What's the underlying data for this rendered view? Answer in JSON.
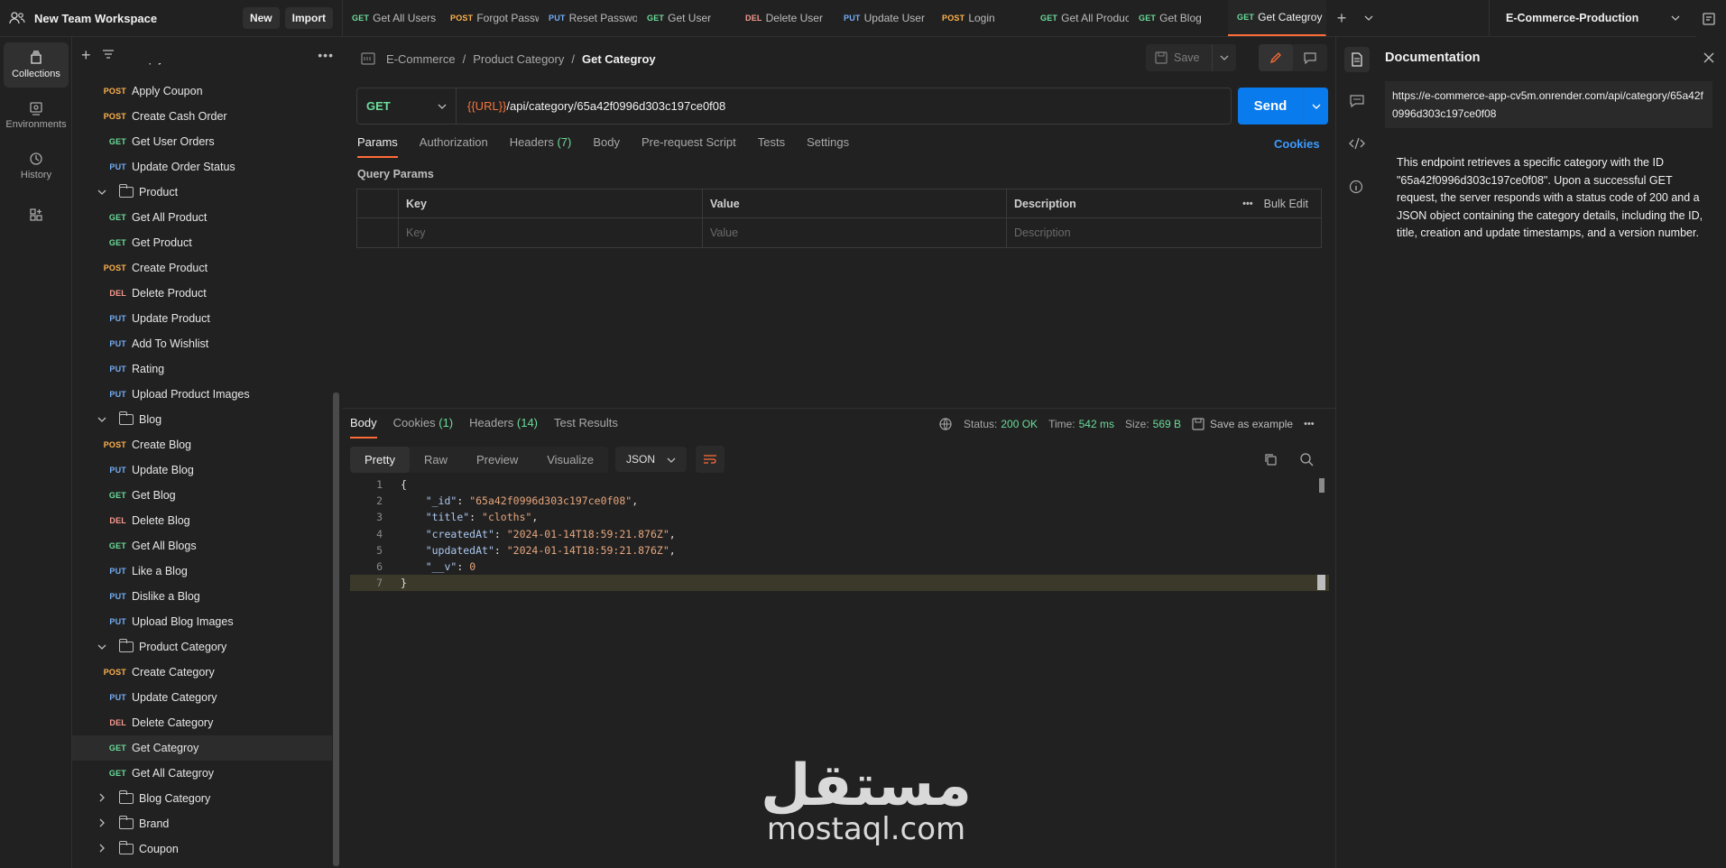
{
  "workspace": {
    "name": "New Team Workspace",
    "new_label": "New",
    "import_label": "Import"
  },
  "rail": [
    {
      "label": "Collections",
      "icon": "collections-icon",
      "active": true
    },
    {
      "label": "Environments",
      "icon": "environments-icon",
      "active": false
    },
    {
      "label": "History",
      "icon": "history-icon",
      "active": false
    }
  ],
  "tree": [
    {
      "kind": "req",
      "method": "",
      "label": "Empty Cart",
      "depth": 2,
      "clipped": true
    },
    {
      "kind": "req",
      "method": "POST",
      "label": "Apply Coupon",
      "depth": 2
    },
    {
      "kind": "req",
      "method": "POST",
      "label": "Create Cash Order",
      "depth": 2
    },
    {
      "kind": "req",
      "method": "GET",
      "label": "Get User Orders",
      "depth": 2
    },
    {
      "kind": "req",
      "method": "PUT",
      "label": "Update Order Status",
      "depth": 2
    },
    {
      "kind": "folder",
      "label": "Product",
      "open": true
    },
    {
      "kind": "req",
      "method": "GET",
      "label": "Get All Product",
      "depth": 2
    },
    {
      "kind": "req",
      "method": "GET",
      "label": "Get Product",
      "depth": 2
    },
    {
      "kind": "req",
      "method": "POST",
      "label": "Create Product",
      "depth": 2
    },
    {
      "kind": "req",
      "method": "DEL",
      "label": "Delete Product",
      "depth": 2
    },
    {
      "kind": "req",
      "method": "PUT",
      "label": "Update Product",
      "depth": 2
    },
    {
      "kind": "req",
      "method": "PUT",
      "label": "Add To Wishlist",
      "depth": 2
    },
    {
      "kind": "req",
      "method": "PUT",
      "label": "Rating",
      "depth": 2
    },
    {
      "kind": "req",
      "method": "PUT",
      "label": "Upload Product Images",
      "depth": 2
    },
    {
      "kind": "folder",
      "label": "Blog",
      "open": true
    },
    {
      "kind": "req",
      "method": "POST",
      "label": "Create Blog",
      "depth": 2
    },
    {
      "kind": "req",
      "method": "PUT",
      "label": "Update Blog",
      "depth": 2
    },
    {
      "kind": "req",
      "method": "GET",
      "label": "Get Blog",
      "depth": 2
    },
    {
      "kind": "req",
      "method": "DEL",
      "label": "Delete Blog",
      "depth": 2
    },
    {
      "kind": "req",
      "method": "GET",
      "label": "Get All Blogs",
      "depth": 2
    },
    {
      "kind": "req",
      "method": "PUT",
      "label": "Like a Blog",
      "depth": 2
    },
    {
      "kind": "req",
      "method": "PUT",
      "label": "Dislike a Blog",
      "depth": 2
    },
    {
      "kind": "req",
      "method": "PUT",
      "label": "Upload Blog Images",
      "depth": 2
    },
    {
      "kind": "folder",
      "label": "Product Category",
      "open": true
    },
    {
      "kind": "req",
      "method": "POST",
      "label": "Create Category",
      "depth": 2
    },
    {
      "kind": "req",
      "method": "PUT",
      "label": "Update Category",
      "depth": 2
    },
    {
      "kind": "req",
      "method": "DEL",
      "label": "Delete Category",
      "depth": 2
    },
    {
      "kind": "req",
      "method": "GET",
      "label": "Get Categroy",
      "depth": 2,
      "selected": true
    },
    {
      "kind": "req",
      "method": "GET",
      "label": "Get All Categroy",
      "depth": 2
    },
    {
      "kind": "folder",
      "label": "Blog Category",
      "open": false
    },
    {
      "kind": "folder",
      "label": "Brand",
      "open": false
    },
    {
      "kind": "folder",
      "label": "Coupon",
      "open": false
    }
  ],
  "tabs": [
    {
      "method": "GET",
      "label": "Get All Users"
    },
    {
      "method": "POST",
      "label": "Forgot Passw"
    },
    {
      "method": "PUT",
      "label": "Reset Passwor"
    },
    {
      "method": "GET",
      "label": "Get User"
    },
    {
      "method": "DEL",
      "label": "Delete User"
    },
    {
      "method": "PUT",
      "label": "Update User"
    },
    {
      "method": "POST",
      "label": "Login"
    },
    {
      "method": "GET",
      "label": "Get All Produc"
    },
    {
      "method": "GET",
      "label": "Get Blog"
    },
    {
      "method": "GET",
      "label": "Get Categroy",
      "active": true
    }
  ],
  "environment": "E-Commerce-Production",
  "breadcrumb": {
    "collection": "E-Commerce",
    "folder": "Product Category",
    "current": "Get Categroy"
  },
  "save_label": "Save",
  "request": {
    "method": "GET",
    "url_var": "{{URL}}",
    "url_path": "/api/category/65a42f0996d303c197ce0f08",
    "send_label": "Send"
  },
  "req_tabs": [
    {
      "label": "Params",
      "active": true
    },
    {
      "label": "Authorization"
    },
    {
      "label": "Headers",
      "count": "(7)"
    },
    {
      "label": "Body"
    },
    {
      "label": "Pre-request Script"
    },
    {
      "label": "Tests"
    },
    {
      "label": "Settings"
    }
  ],
  "cookies_label": "Cookies",
  "query_params": {
    "label": "Query Params",
    "headers": {
      "key": "Key",
      "value": "Value",
      "description": "Description",
      "bulk_edit": "Bulk Edit"
    },
    "placeholders": {
      "key": "Key",
      "value": "Value",
      "description": "Description"
    }
  },
  "response": {
    "tabs": [
      {
        "label": "Body",
        "active": true
      },
      {
        "label": "Cookies",
        "count": "(1)"
      },
      {
        "label": "Headers",
        "count": "(14)"
      },
      {
        "label": "Test Results"
      }
    ],
    "status_label": "Status:",
    "status": "200 OK",
    "time_label": "Time:",
    "time": "542 ms",
    "size_label": "Size:",
    "size": "569 B",
    "save_example": "Save as example",
    "formats": [
      "Pretty",
      "Raw",
      "Preview",
      "Visualize"
    ],
    "format_active": "Pretty",
    "lang": "JSON",
    "lines": [
      {
        "n": "1",
        "text": "{"
      },
      {
        "n": "2",
        "key": "\"_id\"",
        "val": "\"65a42f0996d303c197ce0f08\"",
        "comma": ","
      },
      {
        "n": "3",
        "key": "\"title\"",
        "val": "\"cloths\"",
        "comma": ","
      },
      {
        "n": "4",
        "key": "\"createdAt\"",
        "val": "\"2024-01-14T18:59:21.876Z\"",
        "comma": ","
      },
      {
        "n": "5",
        "key": "\"updatedAt\"",
        "val": "\"2024-01-14T18:59:21.876Z\"",
        "comma": ","
      },
      {
        "n": "6",
        "key": "\"__v\"",
        "val": "0",
        "comma": ""
      },
      {
        "n": "7",
        "text": "}"
      }
    ]
  },
  "docs": {
    "title": "Documentation",
    "url": "https://e-commerce-app-cv5m.onrender.com/api/category/65a42f0996d303c197ce0f08",
    "description": "This endpoint retrieves a specific category with the ID \"65a42f0996d303c197ce0f08\". Upon a successful GET request, the server responds with a status code of 200 and a JSON object containing the category details, including the ID, title, creation and update timestamps, and a version number."
  },
  "watermark": {
    "arabic": "مستقل",
    "latin": "mostaql.com"
  },
  "colors": {
    "accent_orange": "#ff6c37",
    "send_blue": "#097bed",
    "method_get": "#6bdd9a",
    "method_post": "#ffb24d",
    "method_put": "#74aef6",
    "method_del": "#f79a8e"
  }
}
